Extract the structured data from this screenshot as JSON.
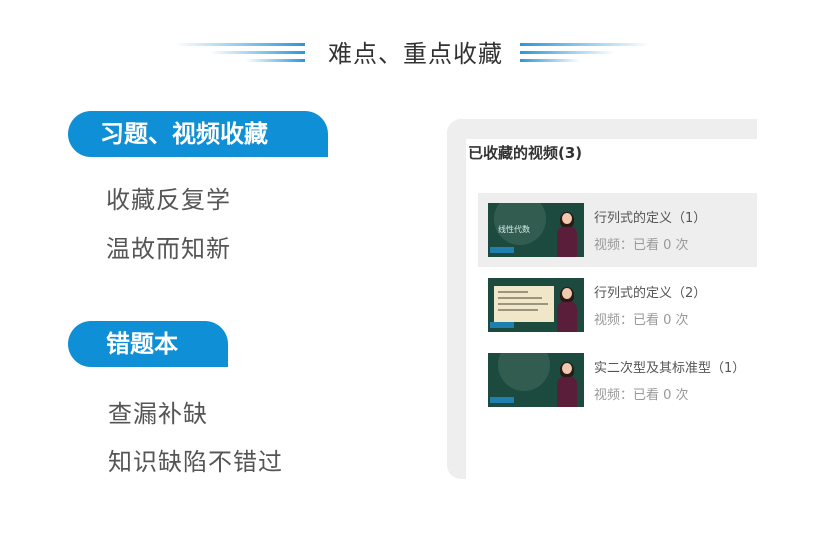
{
  "header": {
    "title": "难点、重点收藏"
  },
  "sections": [
    {
      "tag": "习题、视频收藏",
      "lines": [
        "收藏反复学",
        "温故而知新"
      ]
    },
    {
      "tag": "错题本",
      "lines": [
        "查漏补缺",
        "知识缺陷不错过"
      ]
    }
  ],
  "panel": {
    "title": "已收藏的视频(3)",
    "videos": [
      {
        "title": "行列式的定义（1）",
        "meta": "视频：已看 0 次",
        "thumb_caption": "线性代数"
      },
      {
        "title": "行列式的定义（2）",
        "meta": "视频：已看 0 次"
      },
      {
        "title": "实二次型及其标准型（1）",
        "meta": "视频：已看 0 次"
      }
    ]
  },
  "colors": {
    "accent": "#0f8fd6",
    "thumb_bg": "#1c4a3e"
  }
}
